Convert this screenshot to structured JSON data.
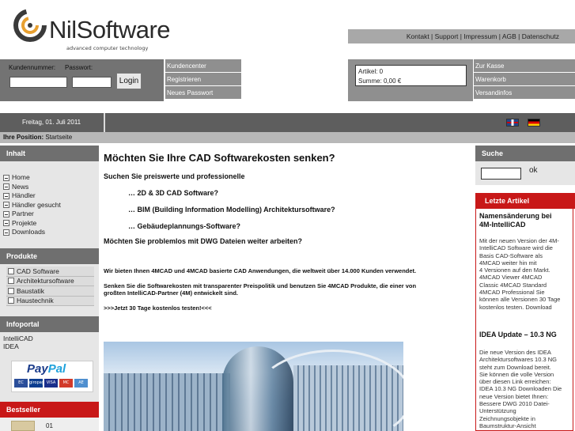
{
  "header": {
    "logo_name_part1": "Nil",
    "logo_name_part2": "Software",
    "logo_tagline": "advanced computer technology",
    "top_nav": [
      "Kontakt",
      "Support",
      "Impressum",
      "AGB",
      "Datenschutz"
    ]
  },
  "login": {
    "customer_number_label": "Kundennummer:",
    "password_label": "Passwort:",
    "login_button": "Login"
  },
  "customer_links": [
    "Kundencenter",
    "Registrieren",
    "Neues Passwort"
  ],
  "cart": {
    "items_label": "Artikel: 0",
    "sum_label": "Summe: 0,00 €"
  },
  "checkout_links": [
    "Zur Kasse",
    "Warenkorb",
    "Versandinfos"
  ],
  "date": "Freitag, 01. Juli 2011",
  "position": {
    "label": "Ihre Position:",
    "value": "Startseite"
  },
  "sidebar": {
    "content_heading": "Inhalt",
    "content_items": [
      "Home",
      "News",
      "Händler",
      "Händler gesucht",
      "Partner",
      "Projekte",
      "Downloads"
    ],
    "products_heading": "Produkte",
    "product_items": [
      "CAD Software",
      "Architektursoftware",
      "Baustatik",
      "Haustechnik"
    ],
    "infoportal_heading": "Infoportal",
    "infoportal_items": [
      "IntelliCAD",
      "IDEA"
    ],
    "paypal_word1": "Pay",
    "paypal_word2": "Pal",
    "payment_cards": [
      "EC",
      "giropay",
      "VISA",
      "MC",
      "AE"
    ],
    "bestseller_heading": "Bestseller",
    "bestseller_first": "01"
  },
  "main": {
    "title": "Möchten Sie Ihre CAD Softwarekosten senken?",
    "line1": "Suchen Sie preiswerte und professionelle",
    "bullet1": "… 2D & 3D CAD Software?",
    "bullet2": "… BIM (Building Information Modelling) Architektursoftware?",
    "bullet3": "… Gebäudeplannungs-Software?",
    "line2": "Möchten Sie problemlos mit DWG Dateien weiter arbeiten?",
    "para1": "Wir bieten Ihnen 4MCAD und 4MCAD basierte CAD Anwendungen, die weltweit über 14.000 Kunden verwendet.",
    "para2_line1": "Senken Sie die Softwarekosten mit transparenter Preispolitik und benutzen Sie 4MCAD Produkte, die einer von",
    "para2_line2": "großten IntelliCAD-Partner (4M) entwickelt sind.",
    "trial_link": ">>>Jetzt 30 Tage kostenlos testen!<<<"
  },
  "right": {
    "search_heading": "Suche",
    "search_button": "ok",
    "news_heading": "Letzte Artikel",
    "news1_title_line1": "Namensänderung bei",
    "news1_title_line2": "4M-IntelliCAD",
    "news1_body": [
      "Mit der neuen Version der 4M-",
      "IntelliCAD Software wird die",
      "Basis CAD-Software als",
      "4MCAD weiter hin mit",
      "4 Versionen auf den Markt.",
      "4MCAD Viewer 4MCAD",
      "Classic 4MCAD Standard",
      "4MCAD Professional Sie",
      "können alle Versionen 30 Tage",
      "kostenlos testen. Download"
    ],
    "news2_title": "IDEA Update – 10.3 NG",
    "news2_body": [
      "Die neue Version des IDEA",
      "Architektursoftwares 10.3 NG",
      "steht zum Download bereit.",
      "Sie können die volle Version",
      "über diesen Link erreichen:",
      "IDEA 10.3 NG Downloaden Die",
      "neue Version bietet Ihnen:",
      "Bessere DWG 2010 Datei-",
      "Unterstützung",
      "Zeichnungsobjekte in",
      "Baumstruktur-Ansicht"
    ]
  },
  "colors": {
    "header_gray": "#a8a8a8",
    "panel_gray": "#737373",
    "accent_red": "#c81818"
  }
}
